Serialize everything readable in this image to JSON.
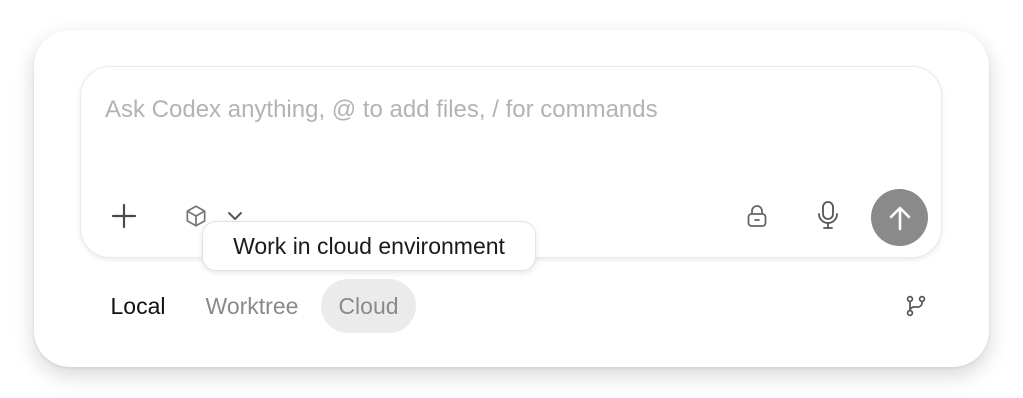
{
  "composer": {
    "placeholder": "Ask Codex anything, @ to add files, / for commands",
    "value": ""
  },
  "toolbar": {
    "add_icon": "plus-icon",
    "environment_icon": "cube-icon",
    "environment_menu_icon": "chevron-down-icon",
    "lock_icon": "lock-icon",
    "mic_icon": "microphone-icon",
    "send_icon": "arrow-up-icon"
  },
  "tooltip": {
    "text": "Work in cloud environment"
  },
  "modes": {
    "items": [
      {
        "label": "Local",
        "active": false
      },
      {
        "label": "Worktree",
        "active": false
      },
      {
        "label": "Cloud",
        "active": true
      }
    ]
  },
  "branch_icon": "git-branch-icon",
  "colors": {
    "send_button": "#8a8a8a",
    "placeholder": "#b3b3b3",
    "active_mode_bg": "#ebebeb",
    "inactive_mode_text": "#8a8a8a"
  }
}
